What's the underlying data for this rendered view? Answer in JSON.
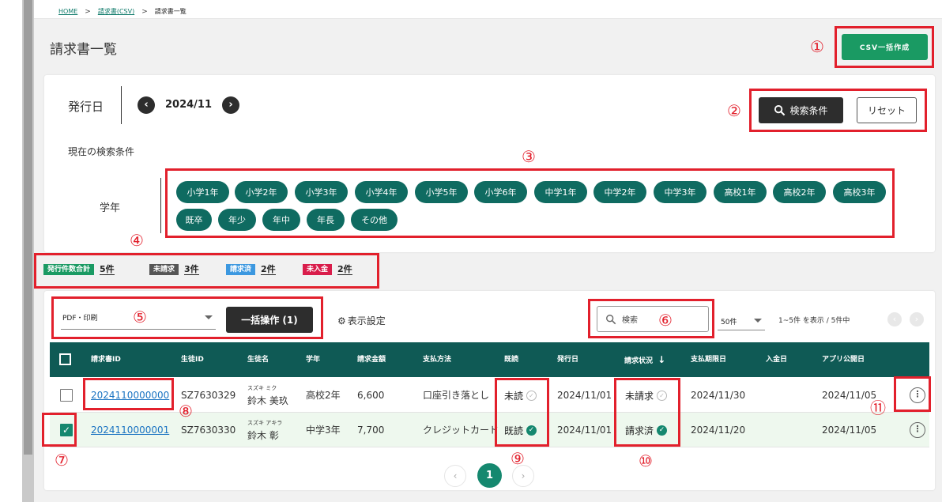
{
  "breadcrumb": {
    "home": "HOME",
    "csv": "請求書(CSV)",
    "current": "請求書一覧",
    "sep": ">"
  },
  "page_title": "請求書一覧",
  "csv_button": "CSV一括作成",
  "filter": {
    "date_label": "発行日",
    "prev": "‹",
    "next": "›",
    "date_value": "2024/11",
    "search_conditions_button": "検索条件",
    "reset_button": "リセット",
    "current_conditions_label": "現在の検索条件",
    "grade_label": "学年",
    "grades": [
      "小学1年",
      "小学2年",
      "小学3年",
      "小学4年",
      "小学5年",
      "小学6年",
      "中学1年",
      "中学2年",
      "中学3年",
      "高校1年",
      "高校2年",
      "高校3年",
      "既卒",
      "年少",
      "年中",
      "年長",
      "その他"
    ]
  },
  "summary": [
    {
      "label": "発行件数合計",
      "count": "5件",
      "color": "#1a9a63"
    },
    {
      "label": "未請求",
      "count": "3件",
      "color": "#555555"
    },
    {
      "label": "請求済",
      "count": "2件",
      "color": "#3c98e0"
    },
    {
      "label": "未入金",
      "count": "2件",
      "color": "#d91d4b"
    }
  ],
  "toolbar": {
    "pdf_select": "PDF・印刷",
    "bulk_button": "一括操作 (1)",
    "display_settings": "表示設定",
    "search_placeholder": "検索",
    "per_page": "50件",
    "range": "1~5件 を表示 / 5件中"
  },
  "table": {
    "headers": [
      "請求書ID",
      "生徒ID",
      "生徒名",
      "学年",
      "請求金額",
      "支払方法",
      "既読",
      "発行日",
      "請求状況",
      "支払期限日",
      "入金日",
      "アプリ公開日"
    ],
    "sort_arrow": "↓",
    "rows": [
      {
        "checked": false,
        "invoice_id": "2024110000000",
        "student_id": "SZ7630329",
        "kana": "スズキ ミク",
        "name": "鈴木 美玖",
        "grade": "高校2年",
        "amount": "6,600",
        "payment": "口座引き落とし",
        "read": "未読",
        "issued": "2024/11/01",
        "status": "未請求",
        "due": "2024/11/30",
        "paid": "",
        "published": "2024/11/05"
      },
      {
        "checked": true,
        "invoice_id": "2024110000001",
        "student_id": "SZ7630330",
        "kana": "スズキ アキラ",
        "name": "鈴木 彰",
        "grade": "中学3年",
        "amount": "7,700",
        "payment": "クレジットカード",
        "read": "既読",
        "issued": "2024/11/01",
        "status": "請求済",
        "due": "2024/11/20",
        "paid": "",
        "published": "2024/11/05"
      }
    ]
  },
  "pagination": {
    "prev": "‹",
    "current": "1",
    "next": "›"
  },
  "annotations": [
    "①",
    "②",
    "③",
    "④",
    "⑤",
    "⑥",
    "⑦",
    "⑧",
    "⑨",
    "⑩",
    "⑪"
  ],
  "icons": {
    "search": "search-icon",
    "gear": "gear-icon",
    "check": "check-icon",
    "kebab": "kebab-icon"
  },
  "accent_color": "#15886f"
}
